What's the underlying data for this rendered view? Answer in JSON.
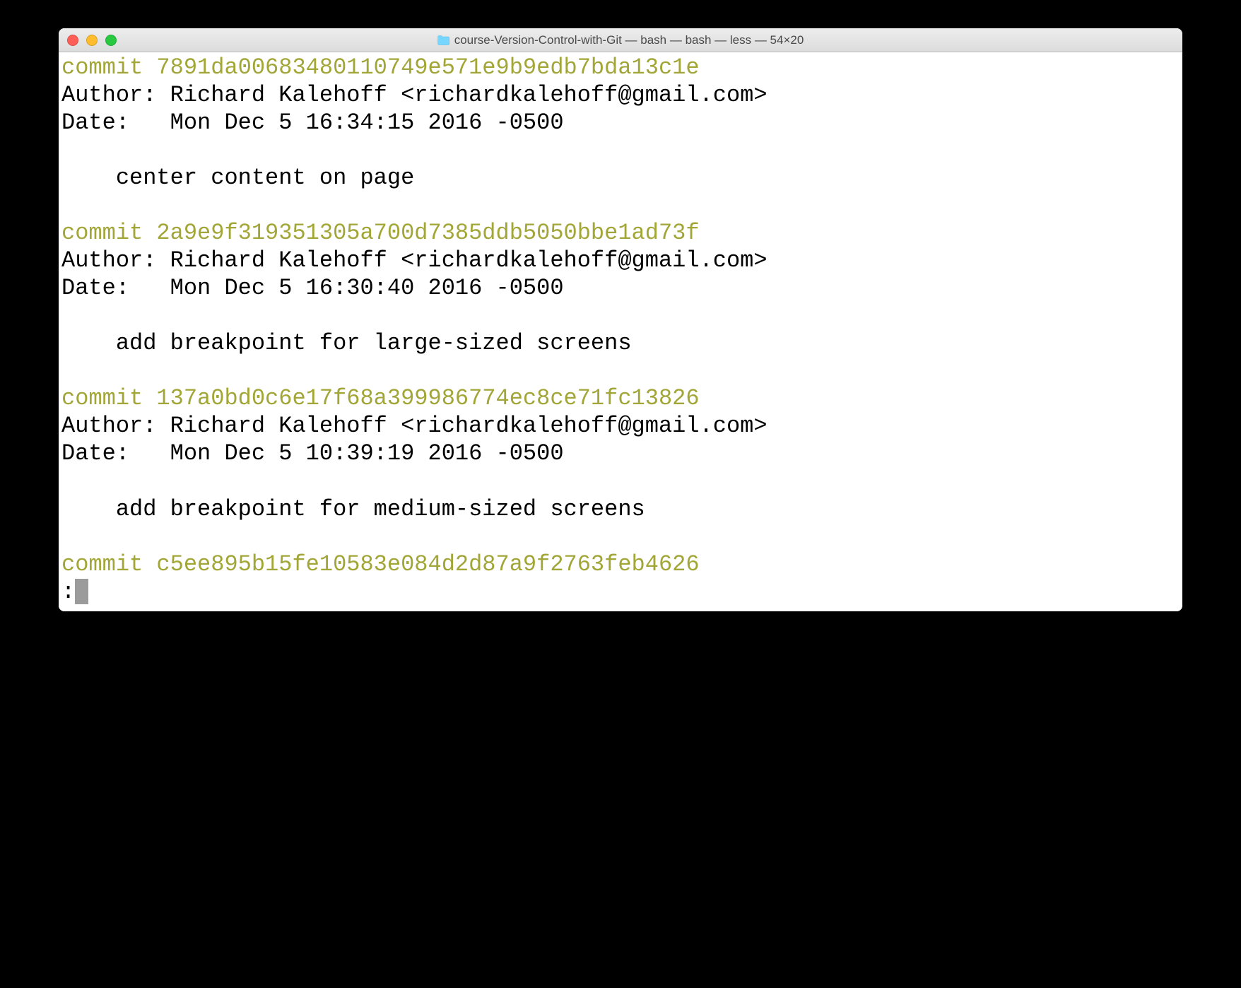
{
  "window": {
    "title": "course-Version-Control-with-Git — bash — bash — less — 54×20"
  },
  "terminal": {
    "commits": [
      {
        "hash_line": "commit 7891da00683480110749e571e9b9edb7bda13c1e",
        "author_line": "Author: Richard Kalehoff <richardkalehoff@gmail.com>",
        "date_line": "Date:   Mon Dec 5 16:34:15 2016 -0500",
        "message": "    center content on page"
      },
      {
        "hash_line": "commit 2a9e9f319351305a700d7385ddb5050bbe1ad73f",
        "author_line": "Author: Richard Kalehoff <richardkalehoff@gmail.com>",
        "date_line": "Date:   Mon Dec 5 16:30:40 2016 -0500",
        "message": "    add breakpoint for large-sized screens"
      },
      {
        "hash_line": "commit 137a0bd0c6e17f68a399986774ec8ce71fc13826",
        "author_line": "Author: Richard Kalehoff <richardkalehoff@gmail.com>",
        "date_line": "Date:   Mon Dec 5 10:39:19 2016 -0500",
        "message": "    add breakpoint for medium-sized screens"
      }
    ],
    "partial_commit_line": "commit c5ee895b15fe10583e084d2d87a9f2763feb4626",
    "prompt": ":"
  }
}
